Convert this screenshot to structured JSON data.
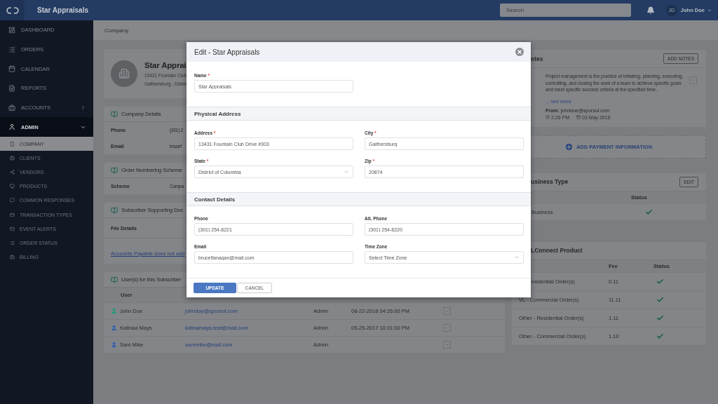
{
  "topbar": {
    "brand": "Star Appraisals",
    "search": {
      "placeholder": "Search"
    },
    "user": {
      "initials": "JD",
      "name": "John Doe"
    }
  },
  "sidebar": {
    "items": [
      {
        "label": "DASHBOARD",
        "kind": "link",
        "selected": false
      },
      {
        "label": "ORDERS",
        "kind": "link",
        "selected": false
      },
      {
        "label": "CALENDAR",
        "kind": "link",
        "selected": false
      },
      {
        "label": "REPORTS",
        "kind": "link",
        "selected": false
      },
      {
        "label": "ACCOUNTS",
        "kind": "group",
        "selected": false,
        "expanded": false
      },
      {
        "label": "ADMIN",
        "kind": "group",
        "selected": true,
        "expanded": true,
        "children": [
          {
            "label": "COMPANY",
            "selected": true
          },
          {
            "label": "CLIENTS",
            "selected": false
          },
          {
            "label": "VENDORS",
            "selected": false
          },
          {
            "label": "PRODUCTS",
            "selected": false
          },
          {
            "label": "COMMON RESPONSES",
            "selected": false
          },
          {
            "label": "TRANSACTION TYPES",
            "selected": false
          },
          {
            "label": "EVENT ALERTS",
            "selected": false
          },
          {
            "label": "ORDER STATUS",
            "selected": false
          },
          {
            "label": "BILLING",
            "selected": false
          }
        ]
      }
    ]
  },
  "breadcrumb": "Company",
  "profile": {
    "name": "Star Apprai",
    "address_1": "13431 Fountain Club",
    "address_2": "Gaithersburg , Distric"
  },
  "company_details": {
    "title": "Company Details",
    "rows": [
      {
        "label": "Phone",
        "value": "(301) 2"
      },
      {
        "label": "Email",
        "value": "brucef"
      }
    ]
  },
  "order_numbering": {
    "title": "Order Numbering Scheme",
    "rows": [
      {
        "label": "Scheme",
        "value": "Compa"
      }
    ]
  },
  "supporting_docs": {
    "title": "Subscriber Supporting Doc",
    "rows": [
      {
        "label": "File Details"
      }
    ],
    "link": "Accounts Payable does not add"
  },
  "users": {
    "title": "User(s) for this Subscriber",
    "columns": [
      "User"
    ],
    "rows": [
      {
        "name": "John Doe",
        "email": "johndoe@spursol.com",
        "role": "Admin",
        "date": "08-22-2018 04:26:00 PM",
        "color": "#1e9e7a"
      },
      {
        "name": "Katinaa Mays",
        "email": "katinamays.test@mail.com",
        "role": "Admin",
        "date": "05-25-2017 10:31:00 PM",
        "color": "#2f5fb0"
      },
      {
        "name": "Sam Mike",
        "email": "sammike@mail.com",
        "role": "Admin",
        "color": "#2f5fb0"
      }
    ]
  },
  "notes": {
    "title": "otes",
    "button": "ADD NOTES",
    "text": "Project management is the practice of initiating, planning, executing, controlling, and closing the work of a team to achieve specific goals and meet specific success criteria at the specified time..",
    "see_more": "... see more",
    "from_label": "From:",
    "from": "johndoe@spursol.com",
    "time": "2:26 PM",
    "date": "03 May 2018"
  },
  "payment": {
    "label": "ADD PAYMENT INFORMATION"
  },
  "business_type": {
    "title": "usiness Type",
    "button": "EDIT",
    "columns": [
      "Status"
    ],
    "rows": [
      {
        "label": "Business",
        "covered": true,
        "checked": true
      }
    ]
  },
  "product": {
    "title": "LConnect Product",
    "columns": [
      "Fee",
      "Status"
    ],
    "rows": [
      {
        "label": "esidential Order(s)",
        "covered": true,
        "fee": "0.11",
        "checked": true
      },
      {
        "label": "VL - Commercial Order(s)",
        "covered": false,
        "fee": "11.11",
        "checked": true
      },
      {
        "label": "Other - Residential Order(s)",
        "covered": false,
        "fee": "1.11",
        "checked": true
      },
      {
        "label": "Other - Commercial Order(s)",
        "covered": false,
        "fee": "1.10",
        "checked": true
      }
    ]
  },
  "modal": {
    "title": "Edit - Star Appraisals",
    "required_mark": "*",
    "sections": [
      {
        "fields": [
          {
            "label": "Name",
            "required": true,
            "kind": "text",
            "value": "Star Appraisals"
          }
        ]
      },
      {
        "title": "Physical Address",
        "fields": [
          {
            "label": "Address",
            "required": true,
            "kind": "text",
            "value": "13431 Fountain Club Drive #303"
          },
          {
            "label": "City",
            "required": true,
            "kind": "text",
            "value": "Gaithersburg"
          },
          {
            "label": "State",
            "required": true,
            "kind": "select",
            "value": "District of Columbia"
          },
          {
            "label": "Zip",
            "required": true,
            "kind": "text",
            "value": "20874"
          }
        ]
      },
      {
        "title": "Contact Details",
        "fields": [
          {
            "label": "Phone",
            "required": false,
            "kind": "text",
            "value": "(301) 254-8221"
          },
          {
            "label": "Alt. Phone",
            "required": false,
            "kind": "text",
            "value": "(301) 254-8220"
          },
          {
            "label": "Email",
            "required": false,
            "kind": "text",
            "value": "bruceflanagan@mail.com"
          },
          {
            "label": "Time Zone",
            "required": false,
            "kind": "select",
            "placeholder": "Select Time Zone"
          }
        ]
      }
    ],
    "buttons": [
      {
        "label": "UPDATE",
        "kind": "primary"
      },
      {
        "label": "CANCEL",
        "kind": "secondary"
      }
    ]
  }
}
